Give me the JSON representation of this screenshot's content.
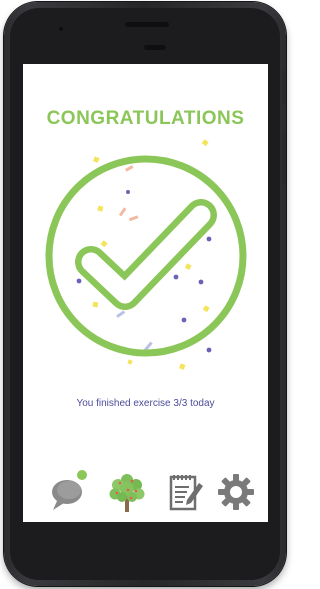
{
  "screen": {
    "title": "CONGRATULATIONS",
    "message": "You finished exercise 3/3 today"
  },
  "nav": {
    "items": [
      {
        "name": "chat",
        "icon": "chat-bubbles-icon",
        "has_notification": true
      },
      {
        "name": "tree",
        "icon": "tree-icon",
        "has_notification": false
      },
      {
        "name": "notes",
        "icon": "notepad-pencil-icon",
        "has_notification": false
      },
      {
        "name": "settings",
        "icon": "gear-icon",
        "has_notification": false
      }
    ]
  },
  "colors": {
    "accent_green": "#8bc658",
    "message_text": "#4b4b9a",
    "icon_gray": "#7a7a7a",
    "confetti": [
      "#f5e35b",
      "#f4b9a2",
      "#6a62b5",
      "#b9c2e6"
    ]
  }
}
